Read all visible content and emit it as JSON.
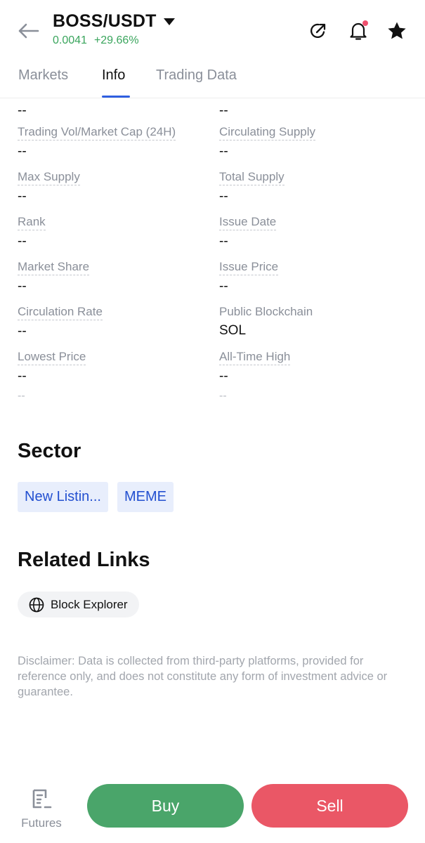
{
  "header": {
    "pair": "BOSS/USDT",
    "price": "0.0041",
    "change": "+29.66%"
  },
  "tabs": [
    {
      "label": "Markets",
      "active": false
    },
    {
      "label": "Info",
      "active": true
    },
    {
      "label": "Trading Data",
      "active": false
    }
  ],
  "info": {
    "top_values": [
      "--",
      "--"
    ],
    "rows": [
      [
        {
          "label": "Trading Vol/Market Cap (24H)",
          "value": "--"
        },
        {
          "label": "Circulating Supply",
          "value": "--"
        }
      ],
      [
        {
          "label": "Max Supply",
          "value": "--"
        },
        {
          "label": "Total Supply",
          "value": "--"
        }
      ],
      [
        {
          "label": "Rank",
          "value": "--"
        },
        {
          "label": "Issue Date",
          "value": "--"
        }
      ],
      [
        {
          "label": "Market Share",
          "value": "--"
        },
        {
          "label": "Issue Price",
          "value": "--"
        }
      ],
      [
        {
          "label": "Circulation Rate",
          "value": "--"
        },
        {
          "label": "Public Blockchain",
          "value": "SOL"
        }
      ],
      [
        {
          "label": "Lowest Price",
          "value": "--"
        },
        {
          "label": "All-Time High",
          "value": "--"
        }
      ]
    ],
    "sub_values": [
      "--",
      "--"
    ]
  },
  "sector": {
    "title": "Sector",
    "tags": [
      "New Listin...",
      "MEME"
    ]
  },
  "related_links": {
    "title": "Related Links",
    "links": [
      {
        "label": "Block Explorer",
        "icon": "globe-icon"
      }
    ]
  },
  "disclaimer": "Disclaimer: Data is collected from third-party platforms, provided for reference only, and does not constitute any form of investment advice or guarantee.",
  "bottom_bar": {
    "futures_label": "Futures",
    "buy_label": "Buy",
    "sell_label": "Sell"
  },
  "colors": {
    "positive": "#3aa55d",
    "accent": "#2f5fe0",
    "buy": "#4aa56a",
    "sell": "#ea5766"
  }
}
